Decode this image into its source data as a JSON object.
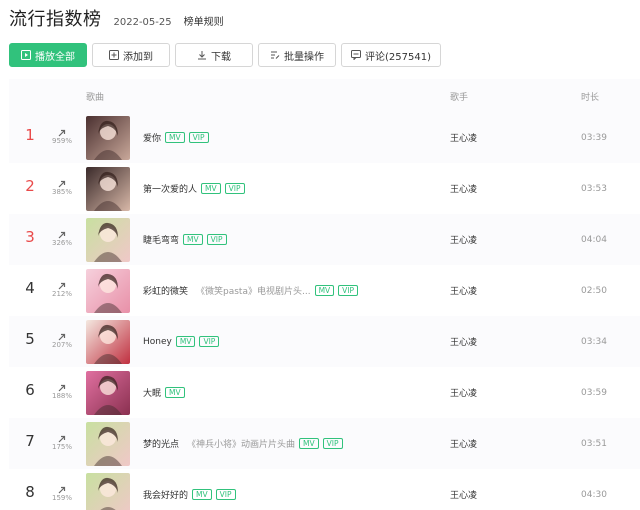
{
  "header": {
    "title": "流行指数榜",
    "date": "2022-05-25",
    "rules_link": "榜单规则"
  },
  "toolbar": {
    "play_all": "播放全部",
    "add_to": "添加到",
    "download": "下载",
    "batch": "批量操作",
    "comment": "评论(257541)"
  },
  "columns": {
    "song": "歌曲",
    "singer": "歌手",
    "duration": "时长"
  },
  "songs": [
    {
      "rank": "1",
      "change": "959%",
      "title": "爱你",
      "subtitle": "",
      "mv": "MV",
      "vip": "VIP",
      "singer": "王心凌",
      "duration": "03:39",
      "cover": [
        "#4a3030",
        "#c9a89a"
      ]
    },
    {
      "rank": "2",
      "change": "385%",
      "title": "第一次爱的人",
      "subtitle": "",
      "mv": "MV",
      "vip": "VIP",
      "singer": "王心凌",
      "duration": "03:53",
      "cover": [
        "#3a2a2a",
        "#d8b8a8"
      ]
    },
    {
      "rank": "3",
      "change": "326%",
      "title": "睫毛弯弯",
      "subtitle": "",
      "mv": "MV",
      "vip": "VIP",
      "singer": "王心凌",
      "duration": "04:04",
      "cover": [
        "#c8e0a0",
        "#f0c8c8"
      ]
    },
    {
      "rank": "4",
      "change": "212%",
      "title": "彩虹的微笑",
      "subtitle": "《微笑pasta》电视剧片头...",
      "mv": "MV",
      "vip": "VIP",
      "singer": "王心凌",
      "duration": "02:50",
      "cover": [
        "#f6d0dc",
        "#e890a8"
      ]
    },
    {
      "rank": "5",
      "change": "207%",
      "title": "Honey",
      "subtitle": "",
      "mv": "MV",
      "vip": "VIP",
      "singer": "王心凌",
      "duration": "03:34",
      "cover": [
        "#f4e8e0",
        "#c03040"
      ]
    },
    {
      "rank": "6",
      "change": "188%",
      "title": "大眠",
      "subtitle": "",
      "mv": "MV",
      "vip": "",
      "singer": "王心凌",
      "duration": "03:59",
      "cover": [
        "#e070a0",
        "#8a3050"
      ]
    },
    {
      "rank": "7",
      "change": "175%",
      "title": "梦的光点",
      "subtitle": "《神兵小将》动画片片头曲",
      "mv": "MV",
      "vip": "VIP",
      "singer": "王心凌",
      "duration": "03:51",
      "cover": [
        "#c8e0a0",
        "#f0c8c8"
      ]
    },
    {
      "rank": "8",
      "change": "159%",
      "title": "我会好好的",
      "subtitle": "",
      "mv": "MV",
      "vip": "VIP",
      "singer": "王心凌",
      "duration": "04:30",
      "cover": [
        "#c8e0a0",
        "#f0c8c8"
      ]
    }
  ],
  "colors": {
    "accent": "#31c27c",
    "top_rank": "#e94a4a"
  }
}
